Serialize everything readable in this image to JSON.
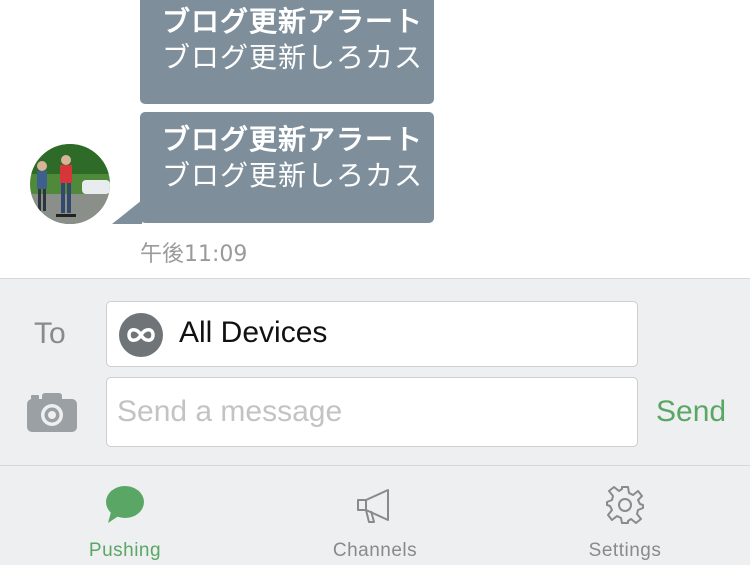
{
  "messages": [
    {
      "title": "ブログ更新アラート",
      "body": "ブログ更新しろカス"
    },
    {
      "title": "ブログ更新アラート",
      "body": "ブログ更新しろカス"
    }
  ],
  "timestamp": "午後11:09",
  "composer": {
    "to_label": "To",
    "to_value": "All Devices",
    "message_placeholder": "Send a message",
    "send_label": "Send"
  },
  "tabs": [
    {
      "label": "Pushing",
      "icon": "speech-bubble-icon",
      "active": true
    },
    {
      "label": "Channels",
      "icon": "megaphone-icon",
      "active": false
    },
    {
      "label": "Settings",
      "icon": "gear-icon",
      "active": false
    }
  ],
  "colors": {
    "bubble": "#7e8f9b",
    "accent": "#5aa765",
    "inactive": "#8a8a8a",
    "panel": "#eeeff0"
  }
}
